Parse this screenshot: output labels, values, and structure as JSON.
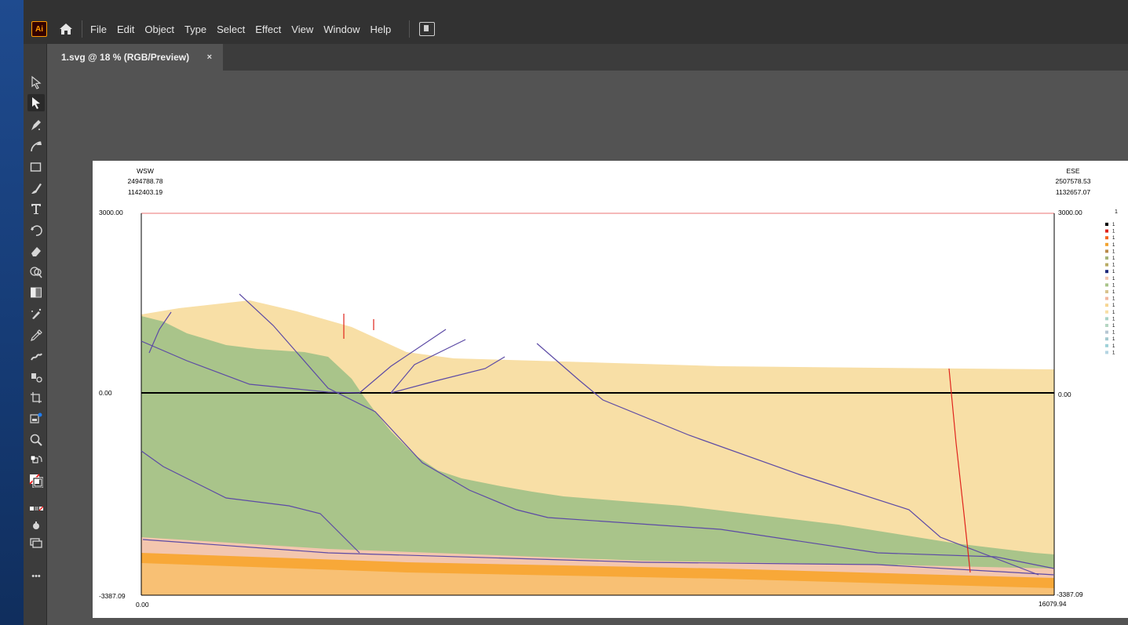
{
  "app": {
    "logo_text": "Ai",
    "logo_icon": "ai-logo-icon",
    "home_icon": "home-icon"
  },
  "menu": [
    "File",
    "Edit",
    "Object",
    "Type",
    "Select",
    "Effect",
    "View",
    "Window",
    "Help"
  ],
  "document_tab": {
    "label": "1.svg @ 18 % (RGB/Preview)",
    "close": "×"
  },
  "tools": [
    "selection-tool-icon",
    "direct-selection-tool-icon",
    "pen-tool-icon",
    "curvature-tool-icon",
    "rectangle-tool-icon",
    "paintbrush-tool-icon",
    "type-tool-icon",
    "rotate-tool-icon",
    "eraser-tool-icon",
    "shape-builder-tool-icon",
    "gradient-tool-icon",
    "eyedropper-blend-tool-icon",
    "eyedropper-tool-icon",
    "blob-brush-tool-icon",
    "symbol-sprayer-tool-icon",
    "artboard-tool-icon",
    "graph-tool-icon",
    "zoom-tool-icon",
    "swap-fill-stroke-icon",
    "fill-stroke-icon",
    "color-mode-icon",
    "draw-mode-icon",
    "screen-mode-icon",
    "more-tools-icon"
  ],
  "more_tools_label": "•••",
  "section": {
    "left_header": {
      "direction": "WSW",
      "x_coord": "2494788.78",
      "y_coord": "1142403.19"
    },
    "right_header": {
      "direction": "ESE",
      "x_coord": "2507578.53",
      "y_coord": "1132657.07"
    },
    "y_axis": {
      "top": "3000.00",
      "zero": "0.00",
      "bottom": "-3387.09"
    },
    "x_axis": {
      "left": "0.00",
      "right": "16079.94"
    },
    "legend_header": "1",
    "legend": [
      {
        "color": "#000000",
        "label": "1"
      },
      {
        "color": "#e0231c",
        "label": "1"
      },
      {
        "color": "#f5651d",
        "label": "1"
      },
      {
        "color": "#f2a330",
        "label": "1"
      },
      {
        "color": "#b98a4a",
        "label": "1"
      },
      {
        "color": "#a4b47a",
        "label": "1"
      },
      {
        "color": "#b8ab64",
        "label": "1"
      },
      {
        "color": "#1f2a7a",
        "label": "1"
      },
      {
        "color": "#f3c6ae",
        "label": "1"
      },
      {
        "color": "#a9c48a",
        "label": "1"
      },
      {
        "color": "#d8c48e",
        "label": "1"
      },
      {
        "color": "#f2b7a0",
        "label": "1"
      },
      {
        "color": "#f6d693",
        "label": "1"
      },
      {
        "color": "#f8dfa6",
        "label": "1"
      },
      {
        "color": "#a9d3c8",
        "label": "1"
      },
      {
        "color": "#b5d6c2",
        "label": "1"
      },
      {
        "color": "#b6c6d2",
        "label": "1"
      },
      {
        "color": "#a4c9cf",
        "label": "1"
      },
      {
        "color": "#9ed1d8",
        "label": "1"
      },
      {
        "color": "#b4d4e2",
        "label": "1"
      }
    ]
  }
}
